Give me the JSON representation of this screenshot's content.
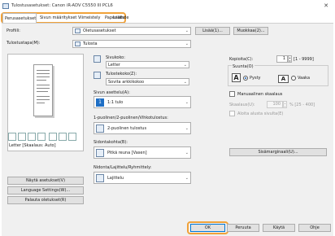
{
  "window": {
    "title": "Tulostusasetukset: Canon iR-ADV C5550 III PCL6"
  },
  "tabs": [
    "Perusasetukset",
    "Sivun määritykset",
    "Viimeistely",
    "Paperilähde",
    "Laatu"
  ],
  "profile": {
    "label": "Profiili:",
    "value": "Oletusasetukset",
    "add": "Lisää(1)...",
    "edit": "Muokkaa(2)..."
  },
  "output_method": {
    "label": "Tulostustapa(M):",
    "value": "Tulosta"
  },
  "preview": {
    "caption": "Letter [Skaalaus: Auto]"
  },
  "original_size": {
    "label": "Sivukoko:",
    "value": "Letter"
  },
  "output_size": {
    "label": "Tulostekoko(Z):",
    "value": "Sovita arkkikokoo"
  },
  "copies": {
    "label": "Kopioita(C):",
    "value": "1",
    "range": "[1 - 9999]"
  },
  "orientation": {
    "label": "Suunta(O)",
    "portrait": "Pysty",
    "landscape": "Vaaka",
    "portrait_letter": "A",
    "landscape_letter": "A"
  },
  "pages_per_sheet": {
    "label": "Sivun asettelu(A):",
    "value": "1:1 tulo",
    "icon_text": "1"
  },
  "manual_scaling": {
    "label": "Manuaalinen skaalaus",
    "sub_label": "Skaalaus(U):",
    "value": "100",
    "range": "% [25 - 400]"
  },
  "watermark": {
    "label": "Aloita alusta sivulta(E)"
  },
  "duplex": {
    "label": "1-puolinen/2-puolinen/Vihkotulostus:",
    "value": "2-puolinen tulostus"
  },
  "binding": {
    "label": "Sidontakohta(B):",
    "value": "Pitkä reuna [Vasen]",
    "margin_btn": "Sisämarginaali(U)..."
  },
  "finishing": {
    "label": "Nidonta/Lajittelu/Ryhmittely:",
    "value": "Lajittelu"
  },
  "left_buttons": {
    "view_settings": "Näytä asetukset(V)",
    "language": "Language Settings(W)...",
    "restore": "Palauta oletukset(R)"
  },
  "bottom_buttons": {
    "ok": "OK",
    "cancel": "Peruuta",
    "apply": "Käytä",
    "help": "Ohje"
  }
}
